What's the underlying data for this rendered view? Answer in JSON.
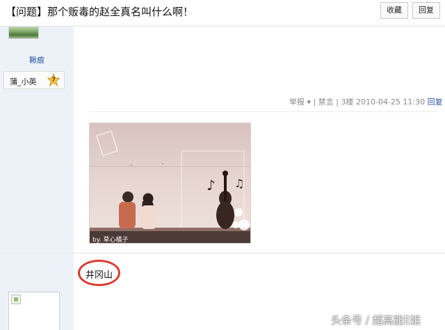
{
  "header": {
    "title": "【问题】那个贩毒的赵全真名叫什么啊！",
    "favorite_label": "收藏",
    "reply_label": "回复"
  },
  "post1": {
    "username": "鞦痕",
    "medal_name": "蒲_小英",
    "medal_level": "7",
    "meta": {
      "report": "举报",
      "ban": "禁言",
      "floor": "3楼",
      "datetime": "2010-04-25 11:30",
      "reply": "回复"
    },
    "image_caption": "by. 草心橘子"
  },
  "post2": {
    "text": "井冈山"
  },
  "watermark": "头条号 / 超高能E姐",
  "colors": {
    "link": "#2a57a0",
    "sidebar_bg": "#edf2f8",
    "circle": "#d83a2e"
  }
}
